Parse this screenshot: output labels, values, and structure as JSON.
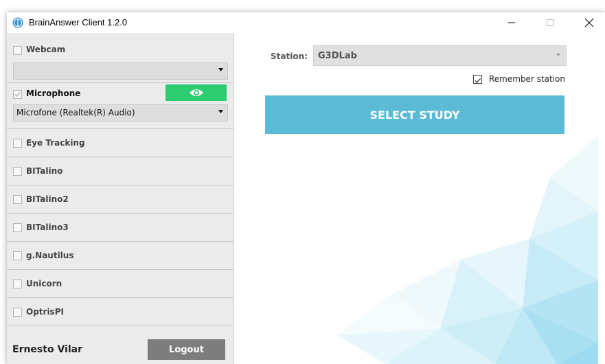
{
  "window": {
    "title": "BrainAnswer Client 1.2.0",
    "controls": [
      "minimize",
      "maximize",
      "close"
    ]
  },
  "sidebar": {
    "webcam": {
      "label": "Webcam",
      "checked": false,
      "device": ""
    },
    "microphone": {
      "label": "Microphone",
      "checked": true,
      "device": "Microfone (Realtek(R) Audio)",
      "preview_icon": "eye-icon"
    },
    "devices": [
      {
        "label": "Eye Tracking",
        "checked": false
      },
      {
        "label": "BITalino",
        "checked": false
      },
      {
        "label": "BITalino2",
        "checked": false
      },
      {
        "label": "BITalino3",
        "checked": false
      },
      {
        "label": "g.Nautilus",
        "checked": false
      },
      {
        "label": "Unicorn",
        "checked": false
      },
      {
        "label": "OptrisPI",
        "checked": false
      }
    ],
    "user": {
      "name": "Ernesto Vilar",
      "logout_label": "Logout"
    }
  },
  "main": {
    "station_label": "Station:",
    "station_value": "G3DLab",
    "remember_label": "Remember station",
    "remember_checked": true,
    "select_study_label": "SELECT STUDY"
  },
  "colors": {
    "accent": "#5bbad5",
    "eye_button": "#2ecc71",
    "logout_button": "#7d7d7d",
    "sidebar_bg": "#ebebeb"
  }
}
